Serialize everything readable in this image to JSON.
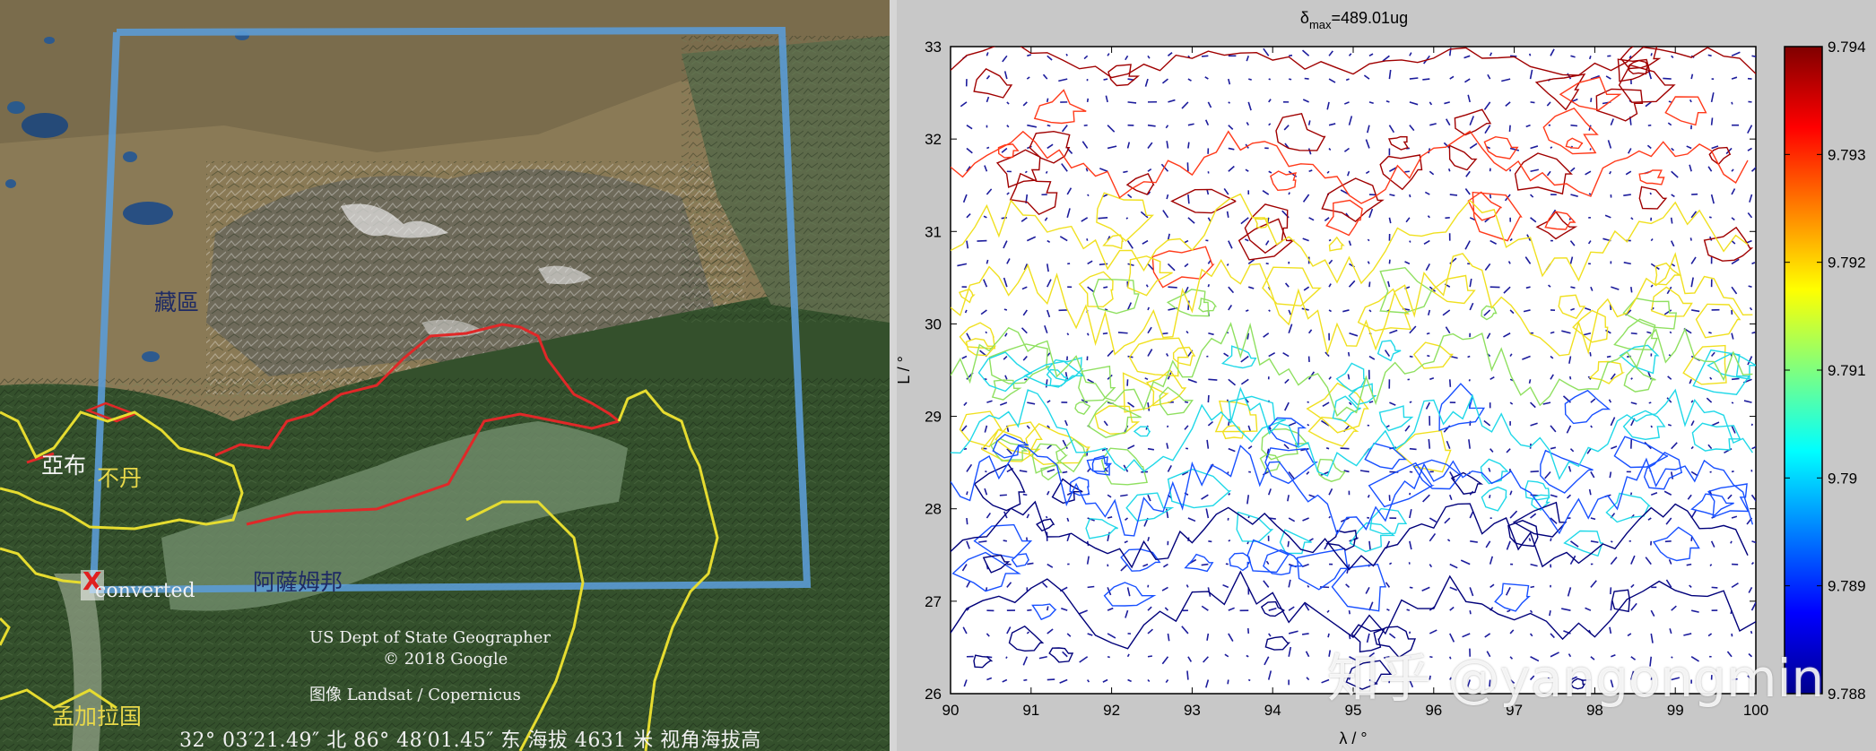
{
  "map": {
    "labels": {
      "region": "藏區",
      "bhutan": "不丹",
      "nepal_part": "亞布",
      "assam": "阿薩姆邦",
      "bangladesh": "孟加拉国",
      "converted": "converted",
      "marker": "X"
    },
    "attribution": {
      "line1": "US Dept of State Geographer",
      "line2": "© 2018 Google",
      "line3": "图像 Landsat / Copernicus"
    },
    "status_bar": "32° 03′21.49″ 北  86° 48′01.45″ 东  海拔  4631 米    视角海拔高"
  },
  "plot": {
    "title_text": "δ",
    "title_sub": "max",
    "title_value": "=489.01ug",
    "xlabel": "λ / °",
    "ylabel": "L / °",
    "colorbar_ticks": [
      "9.794",
      "9.793",
      "9.792",
      "9.791",
      "9.79",
      "9.789",
      "9.788"
    ],
    "watermark": "知乎 @yangongmin"
  },
  "chart_data": {
    "type": "contour",
    "title": "δmax=489.01ug",
    "xlabel": "λ / °",
    "ylabel": "L / °",
    "xlim": [
      90,
      100
    ],
    "ylim": [
      26,
      33
    ],
    "x_ticks": [
      90,
      91,
      92,
      93,
      94,
      95,
      96,
      97,
      98,
      99,
      100
    ],
    "y_ticks": [
      26,
      27,
      28,
      29,
      30,
      31,
      32,
      33
    ],
    "colorbar": {
      "min": 9.788,
      "max": 9.794,
      "ticks": [
        9.794,
        9.793,
        9.792,
        9.791,
        9.79,
        9.789,
        9.788
      ],
      "colormap": "jet"
    },
    "overlay": "quiver (arrows) on regular grid",
    "grid": false
  },
  "colors": {
    "map_box": "#5b9bd5",
    "border_red": "#e02828",
    "border_yellow": "#e6dc30"
  }
}
